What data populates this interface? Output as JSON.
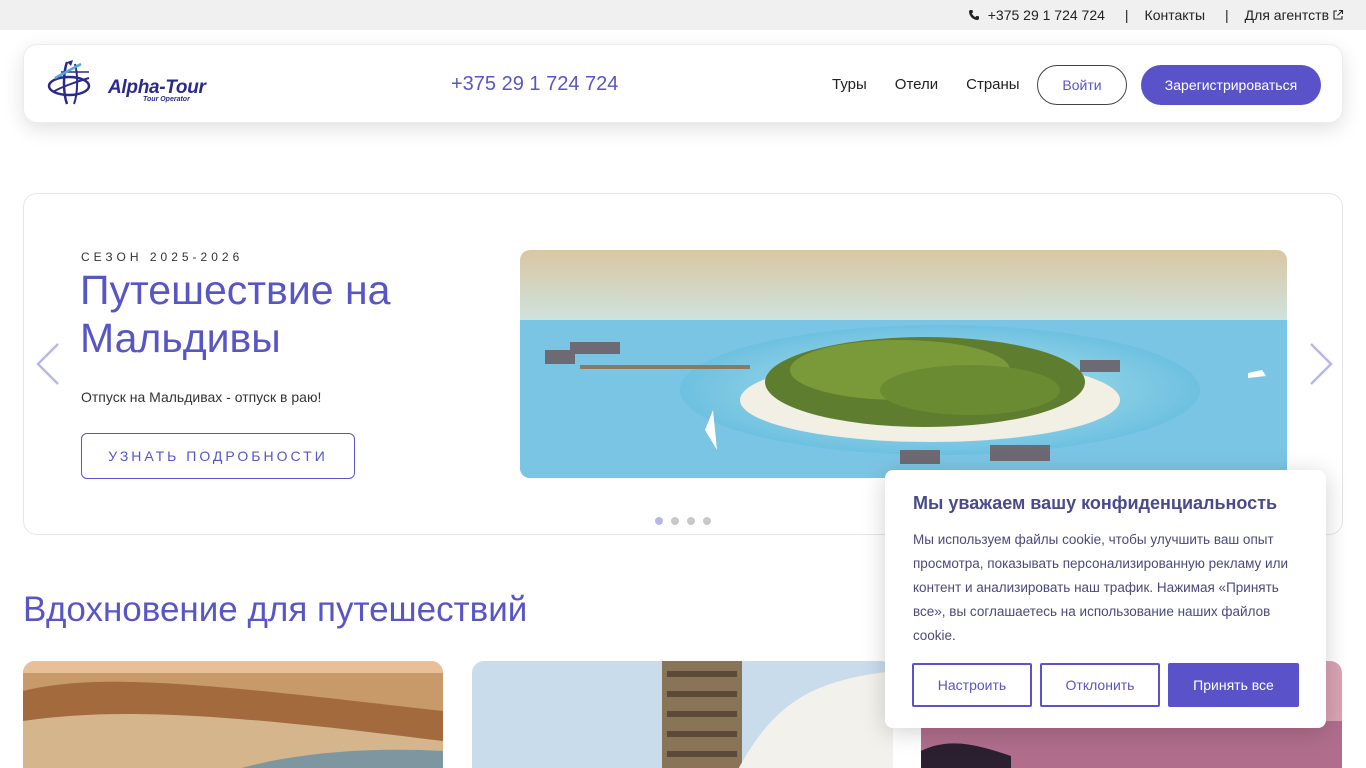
{
  "topbar": {
    "phone": "+375 29 1 724 724",
    "separator": "|",
    "contacts": "Контакты",
    "agencies": "Для агентств"
  },
  "header": {
    "logo_text": "Alpha-Tour",
    "logo_sub": "Tour Operator",
    "phone": "+375 29 1 724 724",
    "nav": [
      "Туры",
      "Отели",
      "Страны"
    ],
    "login": "Войти",
    "register": "Зарегистрироваться"
  },
  "hero": {
    "season": "СЕЗОН 2025-2026",
    "title": "Путешествие на Мальдивы",
    "subtitle": "Отпуск на Мальдивах - отпуск в раю!",
    "button": "УЗНАТЬ ПОДРОБНОСТИ",
    "slides_total": 4,
    "active_slide": 1
  },
  "inspiration": {
    "title": "Вдохновение для путешествий"
  },
  "cookie": {
    "title": "Мы уважаем вашу конфиденциальность",
    "text": "Мы используем файлы cookie, чтобы улучшить ваш опыт просмотра, показывать персонализированную рекламу или контент и анализировать наш трафик. Нажимая «Принять все», вы соглашаетесь на использование наших файлов cookie.",
    "customize": "Настроить",
    "decline": "Отклонить",
    "accept": "Принять все"
  },
  "colors": {
    "accent": "#5855c5",
    "button": "#5a52c8",
    "topbar_bg": "#f0f0f0"
  }
}
